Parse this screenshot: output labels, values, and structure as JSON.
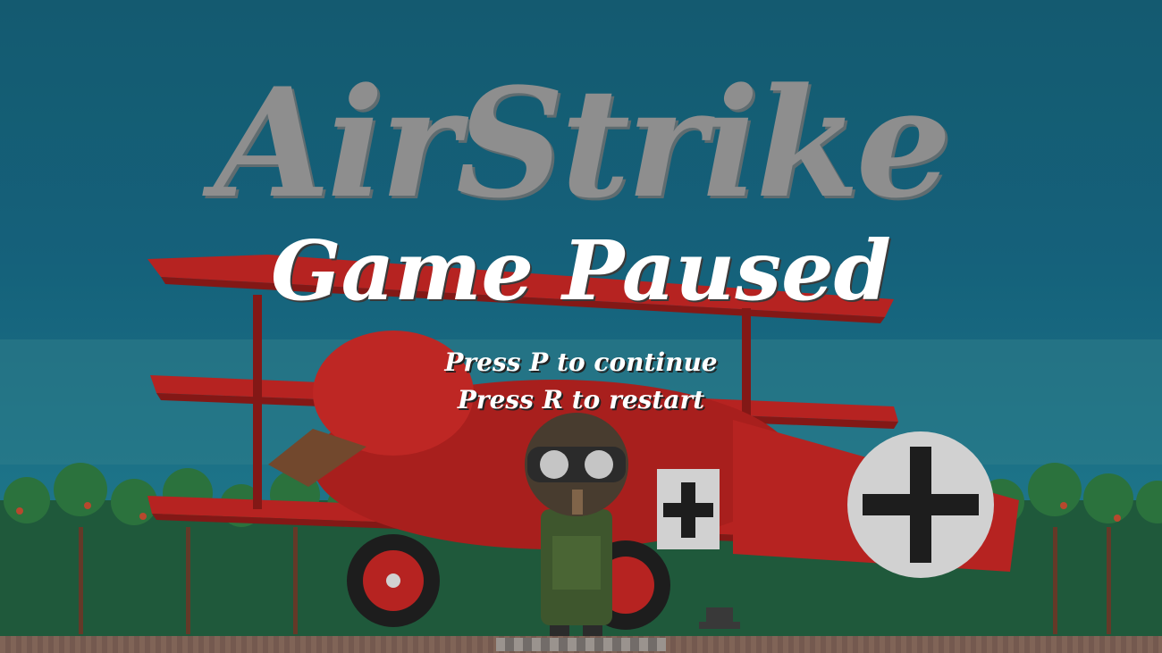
{
  "game": {
    "title": "AirStrike",
    "state": "paused"
  },
  "pause_menu": {
    "heading": "Game Paused",
    "continue_hint": "Press P to continue",
    "restart_hint": "Press R to restart"
  },
  "colors": {
    "sky": "#106784",
    "title": "#8e8e8e",
    "plane_red": "#c8201e",
    "cross": "#1a1a1a",
    "text": "#ffffff"
  }
}
